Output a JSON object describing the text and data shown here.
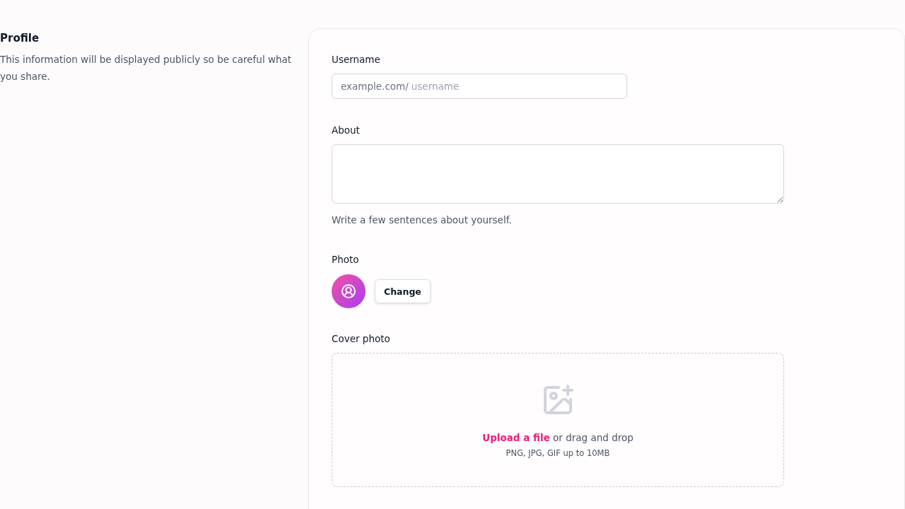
{
  "profile_section": {
    "title": "Profile",
    "description": "This information will be displayed publicly so be careful what you share."
  },
  "form": {
    "username": {
      "label": "Username",
      "prefix": "example.com/",
      "placeholder": "username"
    },
    "about": {
      "label": "About",
      "hint": "Write a few sentences about yourself."
    },
    "photo": {
      "label": "Photo",
      "button": "Change"
    },
    "cover_photo": {
      "label": "Cover photo",
      "upload_link": "Upload a file",
      "upload_text": "or drag and drop",
      "file_types": "PNG, JPG, GIF up to 10MB"
    }
  }
}
